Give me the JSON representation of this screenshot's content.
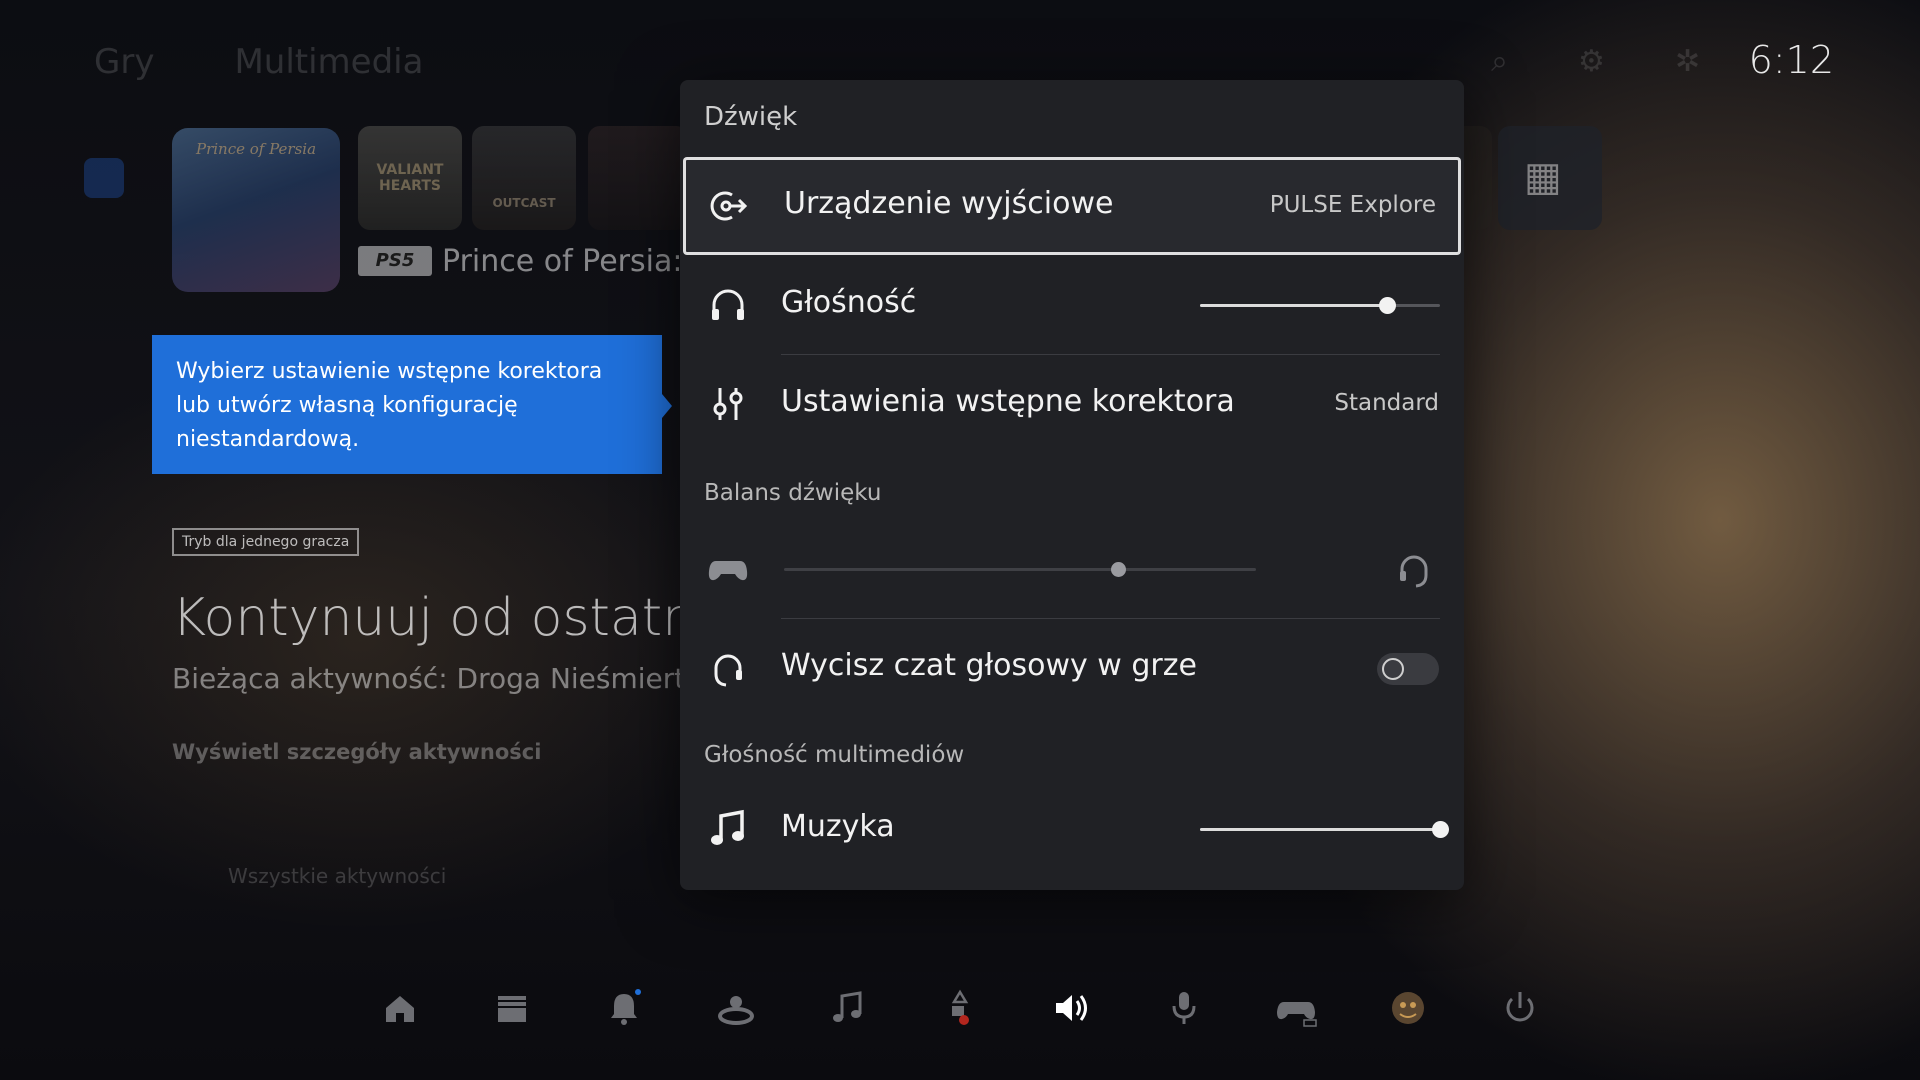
{
  "clock": "6:12",
  "background": {
    "nav": [
      "Gry",
      "Multimedia"
    ],
    "game_tiles": [
      {
        "title": "Prince of Persia"
      },
      {
        "title": "VALIANT HEARTS"
      },
      {
        "title": "OUTCAST"
      }
    ],
    "platform_badge": "PS5",
    "selected_game_title": "Prince of Persia: T",
    "mode_badge": "Tryb dla jednego gracza",
    "continue_heading": "Kontynuuj od ostatni",
    "current_activity": "Bieżąca aktywność: Droga Nieśmierte",
    "view_details": "Wyświetl szczegóły aktywności",
    "all_activities": "Wszystkie aktywności"
  },
  "tooltip": {
    "text": "Wybierz ustawienie wstępne korektora lub utwórz własną konfigurację niestandardową."
  },
  "panel": {
    "title": "Dźwięk",
    "output_device": {
      "label": "Urządzenie wyjściowe",
      "value": "PULSE Explore",
      "icon": "output-device-icon"
    },
    "volume": {
      "label": "Głośność",
      "level": 0.78,
      "icon": "headphones-icon"
    },
    "equalizer": {
      "label": "Ustawienia wstępne korektora",
      "value": "Standard",
      "icon": "equalizer-icon"
    },
    "balance_section": "Balans dźwięku",
    "balance": {
      "level": 0.71,
      "left_icon": "controller-icon",
      "right_icon": "headset-icon"
    },
    "mute_chat": {
      "label": "Wycisz czat głosowy w grze",
      "enabled": false,
      "icon": "headset-icon"
    },
    "media_section": "Głośność multimediów",
    "music": {
      "label": "Muzyka",
      "level": 1.0,
      "icon": "music-note-icon"
    }
  },
  "control_center": [
    {
      "name": "home-icon"
    },
    {
      "name": "game-library-icon"
    },
    {
      "name": "notifications-icon"
    },
    {
      "name": "game-base-icon"
    },
    {
      "name": "music-icon"
    },
    {
      "name": "accessibility-icon"
    },
    {
      "name": "sound-icon",
      "active": true
    },
    {
      "name": "microphone-icon"
    },
    {
      "name": "controller-icon"
    },
    {
      "name": "profile-avatar-icon"
    },
    {
      "name": "power-icon"
    }
  ],
  "colors": {
    "accent": "#1f6fd9",
    "panel_bg": "#202125"
  }
}
